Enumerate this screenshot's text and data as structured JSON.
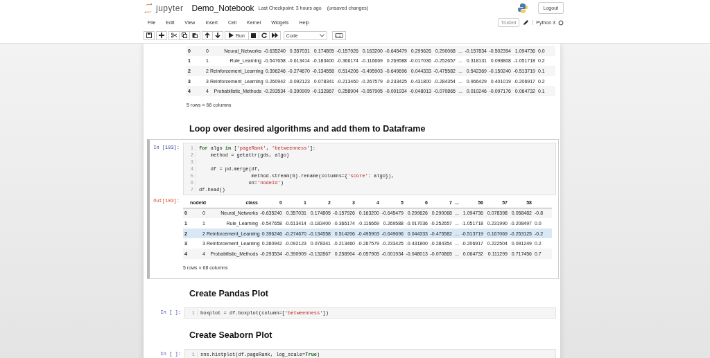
{
  "header": {
    "logo_text": "jupyter",
    "notebook_name": "Demo_Notebook",
    "checkpoint": "Last Checkpoint: 3 hours ago",
    "save_status": "(unsaved changes)",
    "logout": "Logout"
  },
  "menu": [
    "File",
    "Edit",
    "View",
    "Insert",
    "Cell",
    "Kernel",
    "Widgets",
    "Help"
  ],
  "kernel": {
    "trusted": "Trusted",
    "name": "Python 3"
  },
  "toolbar": {
    "run_label": "Run",
    "cell_type": "Code"
  },
  "cells": [
    {
      "kind": "output_table",
      "table": {
        "rows": [
          {
            "selected": false,
            "cells": [
              "0",
              "0",
              "Neural_Networks",
              "-0.635240",
              "0.357031",
              "0.174805",
              "-0.157926",
              "0.163200",
              "-0.645479",
              "0.299626",
              "0.290068",
              "...",
              "-0.157834",
              "-0.502394",
              "1.094736",
              "0.0"
            ]
          },
          {
            "selected": false,
            "cells": [
              "1",
              "1",
              "Rule_Learning",
              "-0.547658",
              "-0.613414",
              "-0.183400",
              "-0.366174",
              "-0.116669",
              "0.269588",
              "-0.017036",
              "-0.252657",
              "...",
              "0.318131",
              "0.098808",
              "-1.051718",
              "0.2"
            ]
          },
          {
            "selected": false,
            "cells": [
              "2",
              "2",
              "Reinforcement_Learning",
              "0.396246",
              "-0.274670",
              "-0.134558",
              "0.514206",
              "-0.495903",
              "-0.649696",
              "0.044333",
              "-0.475582",
              "...",
              "0.542369",
              "-0.150240",
              "-0.513719",
              "0.1"
            ]
          },
          {
            "selected": false,
            "cells": [
              "3",
              "3",
              "Reinforcement_Learning",
              "0.260942",
              "-0.092123",
              "0.078341",
              "-0.213460",
              "-0.267579",
              "-0.233425",
              "-0.431800",
              "-0.284354",
              "...",
              "0.966429",
              "0.401019",
              "-0.206917",
              "0.2"
            ]
          },
          {
            "selected": false,
            "cells": [
              "4",
              "4",
              "Probabilistic_Methods",
              "-0.293534",
              "-0.390909",
              "-0.132867",
              "0.258904",
              "-0.057905",
              "-0.001934",
              "-0.048013",
              "-0.070865",
              "...",
              "0.010246",
              "-0.097176",
              "0.064732",
              "0.1"
            ]
          }
        ],
        "shape": "5 rows × 66 columns"
      }
    },
    {
      "kind": "heading",
      "text": "Loop over desired algorithms and add them to Dataframe"
    },
    {
      "kind": "code",
      "selected": true,
      "prompt": "In [103]:",
      "lines": [
        {
          "number": "1",
          "tokens": [
            {
              "kind": "keyword",
              "text": "for"
            },
            {
              "kind": "plain",
              "text": " algo "
            },
            {
              "kind": "keyword",
              "text": "in"
            },
            {
              "kind": "plain",
              "text": " ["
            },
            {
              "kind": "string",
              "text": "'pageRank'"
            },
            {
              "kind": "plain",
              "text": ", "
            },
            {
              "kind": "string",
              "text": "'betweenness'"
            },
            {
              "kind": "plain",
              "text": "]:"
            }
          ]
        },
        {
          "number": "2",
          "tokens": [
            {
              "kind": "plain",
              "text": "    method = getattr(gds, algo)"
            }
          ]
        },
        {
          "number": "3"
        },
        {
          "number": "4",
          "tokens": [
            {
              "kind": "plain",
              "text": "    df = pd.merge(df,"
            }
          ]
        },
        {
          "number": "5",
          "tokens": [
            {
              "kind": "plain",
              "text": "                  method.stream(G).rename(columns={"
            },
            {
              "kind": "string",
              "text": "'score'"
            },
            {
              "kind": "plain",
              "text": ": algo}),"
            }
          ]
        },
        {
          "number": "6",
          "tokens": [
            {
              "kind": "plain",
              "text": "                 on="
            },
            {
              "kind": "string",
              "text": "'nodeId'"
            },
            {
              "kind": "plain",
              "text": ")"
            }
          ]
        },
        {
          "number": "7",
          "tokens": [
            {
              "kind": "plain",
              "text": "df.head()"
            }
          ]
        }
      ],
      "output": {
        "prompt": "Out[103]:",
        "table": {
          "columns": [
            "",
            "nodeId",
            "class",
            "0",
            "1",
            "2",
            "3",
            "4",
            "5",
            "6",
            "7",
            "...",
            "56",
            "57",
            "58",
            ""
          ],
          "rows": [
            {
              "selected": false,
              "cells": [
                "0",
                "0",
                "Neural_Networks",
                "-0.635240",
                "0.357031",
                "0.174805",
                "-0.157926",
                "0.163200",
                "-0.645479",
                "0.299626",
                "0.290068",
                "...",
                "1.094736",
                "0.078398",
                "0.058482",
                "-0.8"
              ]
            },
            {
              "selected": false,
              "cells": [
                "1",
                "1",
                "Rule_Learning",
                "-0.547658",
                "-0.613414",
                "-0.183400",
                "-0.366174",
                "-0.116669",
                "0.269588",
                "-0.017036",
                "-0.252657",
                "...",
                "-1.051718",
                "0.231990",
                "-0.208497",
                "0.0"
              ]
            },
            {
              "selected": true,
              "cells": [
                "2",
                "2",
                "Reinforcement_Learning",
                "0.396246",
                "-0.274670",
                "-0.134558",
                "0.514206",
                "-0.495903",
                "-0.649696",
                "0.044333",
                "-0.475582",
                "...",
                "-0.513719",
                "0.167069",
                "-0.253125",
                "-0.2"
              ]
            },
            {
              "selected": false,
              "cells": [
                "3",
                "3",
                "Reinforcement_Learning",
                "0.260942",
                "-0.092123",
                "0.078341",
                "-0.213460",
                "-0.267579",
                "-0.233425",
                "-0.431800",
                "-0.284354",
                "...",
                "-0.206917",
                "0.222504",
                "0.091249",
                "0.2"
              ]
            },
            {
              "selected": false,
              "cells": [
                "4",
                "4",
                "Probabilistic_Methods",
                "-0.293534",
                "-0.390909",
                "-0.132867",
                "0.258904",
                "-0.057905",
                "-0.001934",
                "-0.048013",
                "-0.070865",
                "...",
                "0.064732",
                "0.111299",
                "0.717456",
                "0.7"
              ]
            }
          ],
          "shape": "5 rows × 68 columns"
        }
      }
    },
    {
      "kind": "heading",
      "text": "Create Pandas Plot"
    },
    {
      "kind": "code",
      "selected": false,
      "prompt": "In [ ]:",
      "lines": [
        {
          "number": "1",
          "tokens": [
            {
              "kind": "plain",
              "text": "boxplot = df.boxplot(column=["
            },
            {
              "kind": "string",
              "text": "'betweenness'"
            },
            {
              "kind": "plain",
              "text": "])"
            }
          ]
        }
      ]
    },
    {
      "kind": "heading",
      "text": "Create Seaborn Plot"
    },
    {
      "kind": "code",
      "selected": false,
      "prompt": "In [ ]:",
      "lines": [
        {
          "number": "1",
          "tokens": [
            {
              "kind": "plain",
              "text": "sns.histplot(df.pageRank, log_scale="
            },
            {
              "kind": "keyword",
              "text": "True"
            },
            {
              "kind": "plain",
              "text": ")"
            }
          ]
        }
      ]
    }
  ]
}
